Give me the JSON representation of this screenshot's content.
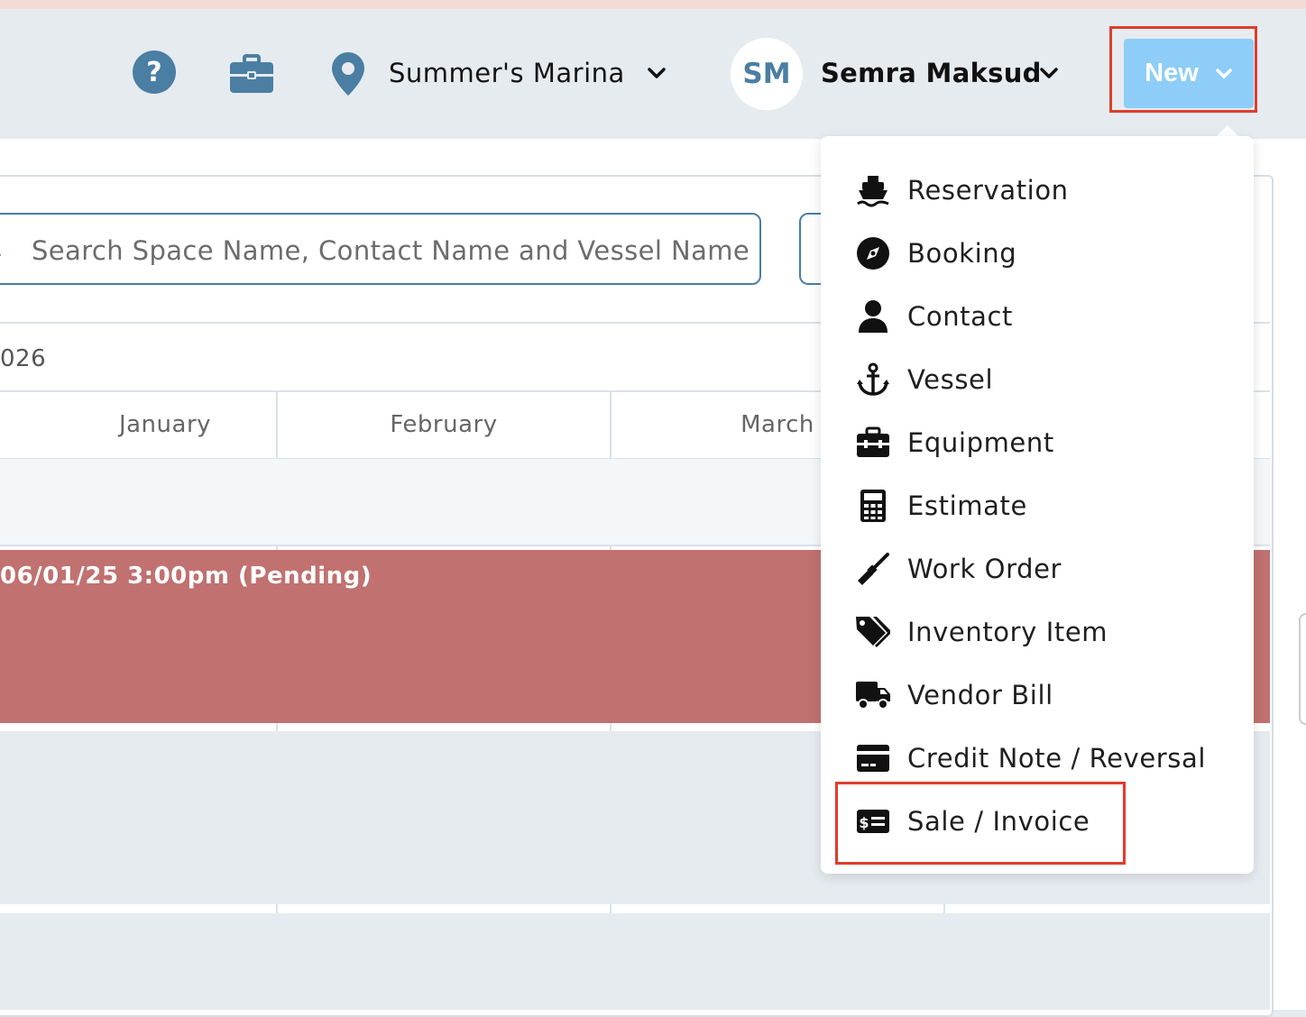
{
  "header": {
    "location_name": "Summer's Marina",
    "user_initials": "SM",
    "user_name": "Semra Maksud",
    "new_button_label": "New",
    "icons": [
      "help-icon",
      "briefcase-icon",
      "location-pin-icon",
      "chevron-down-icon"
    ]
  },
  "search": {
    "placeholder": "Search Space Name, Contact Name and Vessel Name"
  },
  "calendar": {
    "year_label": "026",
    "months": [
      "January",
      "February",
      "March"
    ],
    "event_label": "06/01/25 3:00pm (Pending)"
  },
  "new_menu": {
    "items": [
      {
        "label": "Reservation",
        "icon": "ship-icon"
      },
      {
        "label": "Booking",
        "icon": "compass-icon"
      },
      {
        "label": "Contact",
        "icon": "user-icon"
      },
      {
        "label": "Vessel",
        "icon": "anchor-icon"
      },
      {
        "label": "Equipment",
        "icon": "toolbox-icon"
      },
      {
        "label": "Estimate",
        "icon": "calculator-icon"
      },
      {
        "label": "Work Order",
        "icon": "screwdriver-icon"
      },
      {
        "label": "Inventory Item",
        "icon": "tags-icon"
      },
      {
        "label": "Vendor Bill",
        "icon": "truck-icon"
      },
      {
        "label": "Credit Note / Reversal",
        "icon": "credit-card-icon"
      },
      {
        "label": "Sale / Invoice",
        "icon": "money-check-icon"
      }
    ]
  },
  "colors": {
    "accent": "#4a7ea3",
    "new_button": "#8ecdf7",
    "highlight": "#e03c2c",
    "event": "#c07170"
  }
}
